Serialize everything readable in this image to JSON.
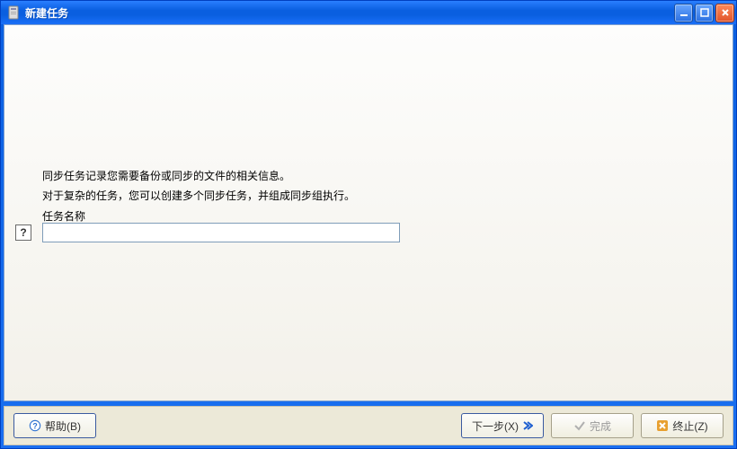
{
  "window": {
    "title": "新建任务"
  },
  "content": {
    "desc_line1": "同步任务记录您需要备份或同步的文件的相关信息。",
    "desc_line2": "对于复杂的任务，您可以创建多个同步任务，并组成同步组执行。",
    "field_label": "任务名称",
    "help_hint": "?",
    "task_name_value": ""
  },
  "buttons": {
    "help": "帮助(B)",
    "next": "下一步(X)",
    "finish": "完成",
    "terminate": "终止(Z)"
  },
  "colors": {
    "titlebar": "#0a5fe0",
    "close": "#e0542a",
    "panel_bg": "#f3f1ea",
    "button_bar": "#ece9d8",
    "next_arrow": "#1e5fd0",
    "terminate_icon": "#e8a030"
  }
}
